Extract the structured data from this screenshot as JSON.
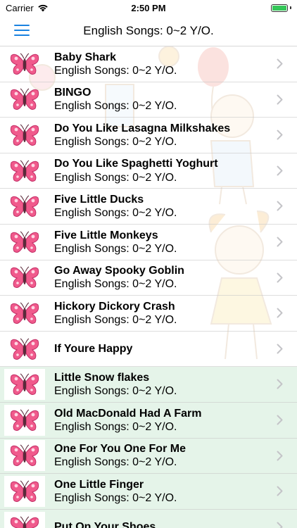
{
  "status_bar": {
    "carrier": "Carrier",
    "time": "2:50 PM",
    "battery_level": 1.0,
    "battery_color": "#35c759"
  },
  "nav": {
    "menu_icon": "hamburger-menu-icon",
    "title": "English Songs: 0~2 Y/O.",
    "accent": "#1a82e0"
  },
  "list": {
    "row_icon": "butterfly-icon",
    "chevron_icon": "chevron-right-icon",
    "items": [
      {
        "title": "Baby Shark",
        "subtitle": "English Songs: 0~2 Y/O."
      },
      {
        "title": "BINGO",
        "subtitle": "English Songs: 0~2 Y/O."
      },
      {
        "title": "Do You Like Lasagna Milkshakes",
        "subtitle": "English Songs: 0~2 Y/O."
      },
      {
        "title": "Do You Like Spaghetti Yoghurt",
        "subtitle": "English Songs: 0~2 Y/O."
      },
      {
        "title": "Five Little Ducks",
        "subtitle": "English Songs: 0~2 Y/O."
      },
      {
        "title": "Five Little Monkeys",
        "subtitle": "English Songs: 0~2 Y/O."
      },
      {
        "title": "Go Away Spooky Goblin",
        "subtitle": "English Songs: 0~2 Y/O."
      },
      {
        "title": "Hickory Dickory Crash",
        "subtitle": "English Songs: 0~2 Y/O."
      },
      {
        "title": "If Youre Happy",
        "subtitle": ""
      },
      {
        "title": "Little Snow flakes",
        "subtitle": "English Songs: 0~2 Y/O."
      },
      {
        "title": "Old MacDonald Had A Farm",
        "subtitle": "English Songs: 0~2 Y/O."
      },
      {
        "title": "One For You One For Me",
        "subtitle": "English Songs: 0~2 Y/O."
      },
      {
        "title": "One Little Finger",
        "subtitle": "English Songs: 0~2 Y/O."
      },
      {
        "title": "Put On Your Shoes",
        "subtitle": ""
      }
    ]
  }
}
